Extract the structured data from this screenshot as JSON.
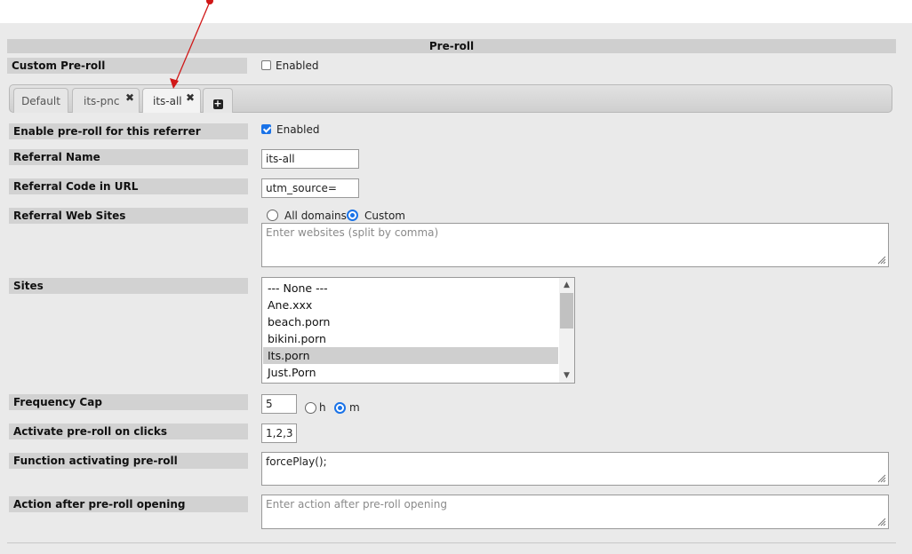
{
  "section": {
    "title": "Pre-roll"
  },
  "custom_preroll": {
    "label": "Custom Pre-roll",
    "checkbox_label": "Enabled",
    "checked": false
  },
  "tabs": [
    {
      "label": "Default",
      "closable": false,
      "active": false
    },
    {
      "label": "its-pnc",
      "closable": true,
      "active": false
    },
    {
      "label": "its-all",
      "closable": true,
      "active": true
    }
  ],
  "tab_close_glyph": "✖",
  "add_tab_glyph": "+",
  "form": {
    "enable": {
      "label": "Enable pre-roll for this referrer",
      "checkbox_label": "Enabled",
      "checked": true
    },
    "referral_name": {
      "label": "Referral Name",
      "value": "its-all"
    },
    "referral_code": {
      "label": "Referral Code in URL",
      "value": "utm_source="
    },
    "referral_sites": {
      "label": "Referral Web Sites",
      "options": [
        "All domains",
        "Custom"
      ],
      "selected": "Custom",
      "placeholder": "Enter websites (split by comma)"
    },
    "sites": {
      "label": "Sites",
      "items": [
        "--- None ---",
        "Ane.xxx",
        "beach.porn",
        "bikini.porn",
        "Its.porn",
        "Just.Porn"
      ],
      "selected": "Its.porn"
    },
    "frequency_cap": {
      "label": "Frequency Cap",
      "value": "5",
      "units": [
        "h",
        "m"
      ],
      "selected_unit": "m"
    },
    "activate_clicks": {
      "label": "Activate pre-roll on clicks",
      "value": "1,2,3"
    },
    "function": {
      "label": "Function activating pre-roll",
      "value": "forcePlay();"
    },
    "action_after": {
      "label": "Action after pre-roll opening",
      "placeholder": "Enter action after pre-roll opening"
    }
  },
  "colors": {
    "accent": "#1a73e8",
    "annotation_arrow": "#d01818",
    "selected_row": "#cfcfcf"
  }
}
